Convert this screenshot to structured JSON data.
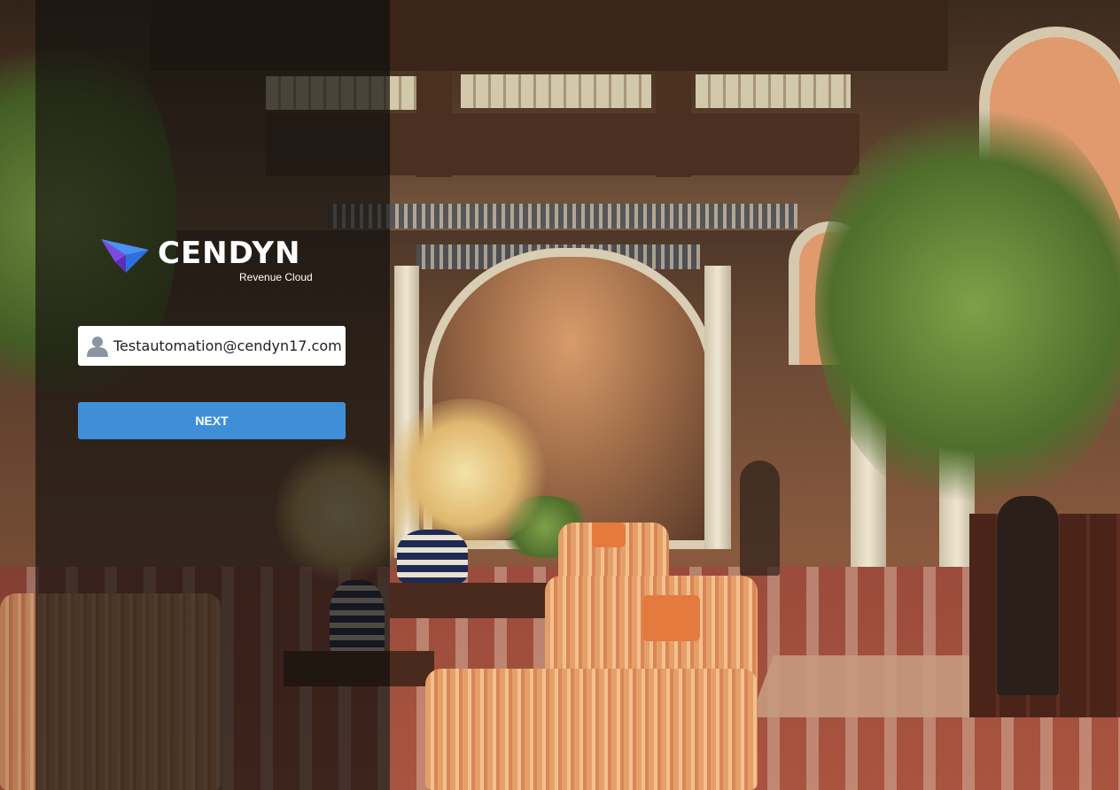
{
  "brand": {
    "name": "CENDYN",
    "tagline": "Revenue Cloud",
    "logo_icon": "cendyn-arrow-logo-icon"
  },
  "login": {
    "email_value": "Testautomation@cendyn17.com",
    "user_icon": "user-icon",
    "next_label": "NEXT"
  },
  "colors": {
    "accent": "#3f8fd8",
    "panel_overlay": "rgba(18,16,14,0.72)",
    "logo_blue": "#3b7ff0",
    "logo_purple": "#7a3fd6"
  }
}
